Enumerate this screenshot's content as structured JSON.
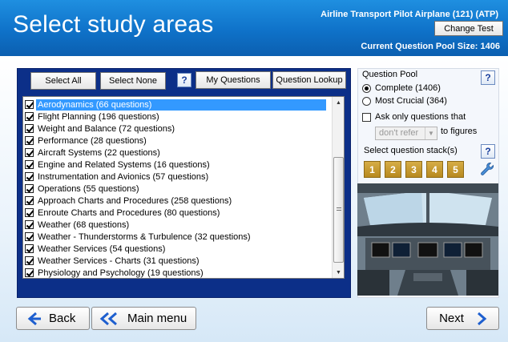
{
  "header": {
    "title": "Select study areas",
    "subtitle": "Airline Transport Pilot Airplane (121) (ATP)",
    "change_test": "Change Test",
    "pool_size": "Current Question Pool Size: 1406"
  },
  "toolbar": {
    "select_all": "Select All",
    "select_none": "Select None",
    "help": "?",
    "my_questions": "My Questions",
    "question_lookup": "Question Lookup"
  },
  "study_areas": [
    {
      "label": "Aerodynamics (66 questions)",
      "checked": true,
      "selected": true
    },
    {
      "label": "Flight Planning (196 questions)",
      "checked": true
    },
    {
      "label": "Weight and Balance (72 questions)",
      "checked": true
    },
    {
      "label": "Performance (28 questions)",
      "checked": true
    },
    {
      "label": "Aircraft Systems (22 questions)",
      "checked": true
    },
    {
      "label": "Engine and Related Systems (16 questions)",
      "checked": true
    },
    {
      "label": "Instrumentation and Avionics (57 questions)",
      "checked": true
    },
    {
      "label": "Operations (55 questions)",
      "checked": true
    },
    {
      "label": "Approach Charts and Procedures (258 questions)",
      "checked": true
    },
    {
      "label": "Enroute Charts and Procedures (80 questions)",
      "checked": true
    },
    {
      "label": "Weather (68 questions)",
      "checked": true
    },
    {
      "label": "Weather - Thunderstorms & Turbulence (32 questions)",
      "checked": true
    },
    {
      "label": "Weather Services (54 questions)",
      "checked": true
    },
    {
      "label": "Weather Services - Charts (31 questions)",
      "checked": true
    },
    {
      "label": "Physiology and Psychology (19 questions)",
      "checked": true
    }
  ],
  "question_pool": {
    "heading": "Question Pool",
    "help": "?",
    "complete": "Complete (1406)",
    "most_crucial": "Most Crucial (364)",
    "selected": "complete",
    "ask_only": "Ask only questions that",
    "refer_select": "don't refer",
    "to_figures": "to figures"
  },
  "stacks": {
    "heading": "Select question stack(s)",
    "help": "?",
    "items": [
      "1",
      "2",
      "3",
      "4",
      "5"
    ]
  },
  "nav": {
    "back": "Back",
    "main_menu": "Main menu",
    "next": "Next"
  },
  "colors": {
    "header_blue": "#1580d6",
    "panel_navy": "#0c2f88",
    "selection": "#3399ff",
    "stack_gold": "#c99a2e",
    "arrow_blue": "#1e5fcf"
  }
}
